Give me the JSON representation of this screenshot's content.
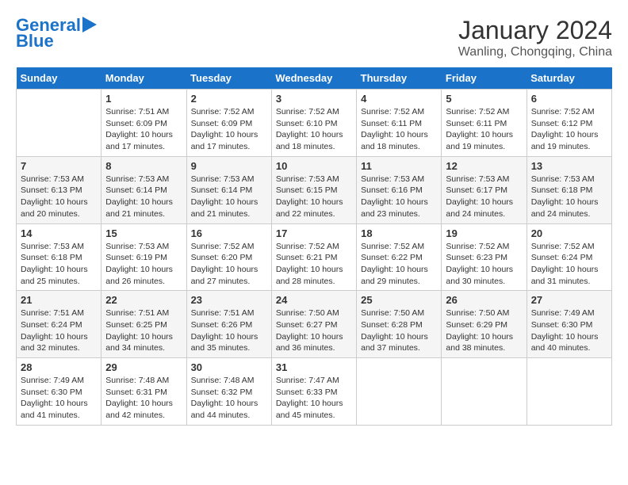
{
  "header": {
    "logo_line1": "General",
    "logo_line2": "Blue",
    "month": "January 2024",
    "location": "Wanling, Chongqing, China"
  },
  "columns": [
    "Sunday",
    "Monday",
    "Tuesday",
    "Wednesday",
    "Thursday",
    "Friday",
    "Saturday"
  ],
  "weeks": [
    [
      {
        "day": "",
        "sunrise": "",
        "sunset": "",
        "daylight": ""
      },
      {
        "day": "1",
        "sunrise": "Sunrise: 7:51 AM",
        "sunset": "Sunset: 6:09 PM",
        "daylight": "Daylight: 10 hours and 17 minutes."
      },
      {
        "day": "2",
        "sunrise": "Sunrise: 7:52 AM",
        "sunset": "Sunset: 6:09 PM",
        "daylight": "Daylight: 10 hours and 17 minutes."
      },
      {
        "day": "3",
        "sunrise": "Sunrise: 7:52 AM",
        "sunset": "Sunset: 6:10 PM",
        "daylight": "Daylight: 10 hours and 18 minutes."
      },
      {
        "day": "4",
        "sunrise": "Sunrise: 7:52 AM",
        "sunset": "Sunset: 6:11 PM",
        "daylight": "Daylight: 10 hours and 18 minutes."
      },
      {
        "day": "5",
        "sunrise": "Sunrise: 7:52 AM",
        "sunset": "Sunset: 6:11 PM",
        "daylight": "Daylight: 10 hours and 19 minutes."
      },
      {
        "day": "6",
        "sunrise": "Sunrise: 7:52 AM",
        "sunset": "Sunset: 6:12 PM",
        "daylight": "Daylight: 10 hours and 19 minutes."
      }
    ],
    [
      {
        "day": "7",
        "sunrise": "Sunrise: 7:53 AM",
        "sunset": "Sunset: 6:13 PM",
        "daylight": "Daylight: 10 hours and 20 minutes."
      },
      {
        "day": "8",
        "sunrise": "Sunrise: 7:53 AM",
        "sunset": "Sunset: 6:14 PM",
        "daylight": "Daylight: 10 hours and 21 minutes."
      },
      {
        "day": "9",
        "sunrise": "Sunrise: 7:53 AM",
        "sunset": "Sunset: 6:14 PM",
        "daylight": "Daylight: 10 hours and 21 minutes."
      },
      {
        "day": "10",
        "sunrise": "Sunrise: 7:53 AM",
        "sunset": "Sunset: 6:15 PM",
        "daylight": "Daylight: 10 hours and 22 minutes."
      },
      {
        "day": "11",
        "sunrise": "Sunrise: 7:53 AM",
        "sunset": "Sunset: 6:16 PM",
        "daylight": "Daylight: 10 hours and 23 minutes."
      },
      {
        "day": "12",
        "sunrise": "Sunrise: 7:53 AM",
        "sunset": "Sunset: 6:17 PM",
        "daylight": "Daylight: 10 hours and 24 minutes."
      },
      {
        "day": "13",
        "sunrise": "Sunrise: 7:53 AM",
        "sunset": "Sunset: 6:18 PM",
        "daylight": "Daylight: 10 hours and 24 minutes."
      }
    ],
    [
      {
        "day": "14",
        "sunrise": "Sunrise: 7:53 AM",
        "sunset": "Sunset: 6:18 PM",
        "daylight": "Daylight: 10 hours and 25 minutes."
      },
      {
        "day": "15",
        "sunrise": "Sunrise: 7:53 AM",
        "sunset": "Sunset: 6:19 PM",
        "daylight": "Daylight: 10 hours and 26 minutes."
      },
      {
        "day": "16",
        "sunrise": "Sunrise: 7:52 AM",
        "sunset": "Sunset: 6:20 PM",
        "daylight": "Daylight: 10 hours and 27 minutes."
      },
      {
        "day": "17",
        "sunrise": "Sunrise: 7:52 AM",
        "sunset": "Sunset: 6:21 PM",
        "daylight": "Daylight: 10 hours and 28 minutes."
      },
      {
        "day": "18",
        "sunrise": "Sunrise: 7:52 AM",
        "sunset": "Sunset: 6:22 PM",
        "daylight": "Daylight: 10 hours and 29 minutes."
      },
      {
        "day": "19",
        "sunrise": "Sunrise: 7:52 AM",
        "sunset": "Sunset: 6:23 PM",
        "daylight": "Daylight: 10 hours and 30 minutes."
      },
      {
        "day": "20",
        "sunrise": "Sunrise: 7:52 AM",
        "sunset": "Sunset: 6:24 PM",
        "daylight": "Daylight: 10 hours and 31 minutes."
      }
    ],
    [
      {
        "day": "21",
        "sunrise": "Sunrise: 7:51 AM",
        "sunset": "Sunset: 6:24 PM",
        "daylight": "Daylight: 10 hours and 32 minutes."
      },
      {
        "day": "22",
        "sunrise": "Sunrise: 7:51 AM",
        "sunset": "Sunset: 6:25 PM",
        "daylight": "Daylight: 10 hours and 34 minutes."
      },
      {
        "day": "23",
        "sunrise": "Sunrise: 7:51 AM",
        "sunset": "Sunset: 6:26 PM",
        "daylight": "Daylight: 10 hours and 35 minutes."
      },
      {
        "day": "24",
        "sunrise": "Sunrise: 7:50 AM",
        "sunset": "Sunset: 6:27 PM",
        "daylight": "Daylight: 10 hours and 36 minutes."
      },
      {
        "day": "25",
        "sunrise": "Sunrise: 7:50 AM",
        "sunset": "Sunset: 6:28 PM",
        "daylight": "Daylight: 10 hours and 37 minutes."
      },
      {
        "day": "26",
        "sunrise": "Sunrise: 7:50 AM",
        "sunset": "Sunset: 6:29 PM",
        "daylight": "Daylight: 10 hours and 38 minutes."
      },
      {
        "day": "27",
        "sunrise": "Sunrise: 7:49 AM",
        "sunset": "Sunset: 6:30 PM",
        "daylight": "Daylight: 10 hours and 40 minutes."
      }
    ],
    [
      {
        "day": "28",
        "sunrise": "Sunrise: 7:49 AM",
        "sunset": "Sunset: 6:30 PM",
        "daylight": "Daylight: 10 hours and 41 minutes."
      },
      {
        "day": "29",
        "sunrise": "Sunrise: 7:48 AM",
        "sunset": "Sunset: 6:31 PM",
        "daylight": "Daylight: 10 hours and 42 minutes."
      },
      {
        "day": "30",
        "sunrise": "Sunrise: 7:48 AM",
        "sunset": "Sunset: 6:32 PM",
        "daylight": "Daylight: 10 hours and 44 minutes."
      },
      {
        "day": "31",
        "sunrise": "Sunrise: 7:47 AM",
        "sunset": "Sunset: 6:33 PM",
        "daylight": "Daylight: 10 hours and 45 minutes."
      },
      {
        "day": "",
        "sunrise": "",
        "sunset": "",
        "daylight": ""
      },
      {
        "day": "",
        "sunrise": "",
        "sunset": "",
        "daylight": ""
      },
      {
        "day": "",
        "sunrise": "",
        "sunset": "",
        "daylight": ""
      }
    ]
  ]
}
